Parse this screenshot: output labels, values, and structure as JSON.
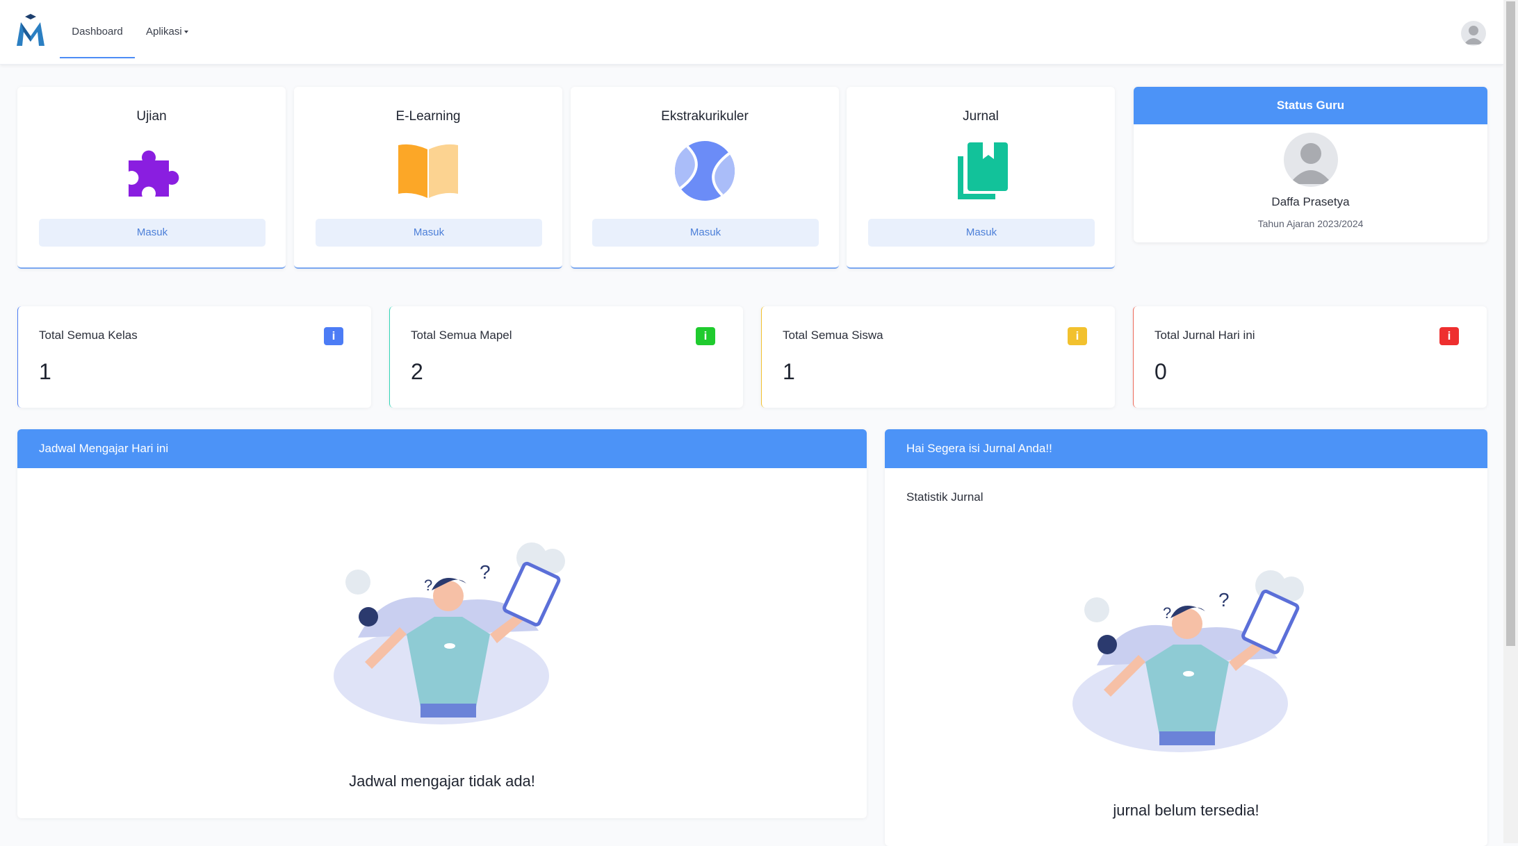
{
  "nav": {
    "items": [
      {
        "label": "Dashboard",
        "active": true
      },
      {
        "label": "Aplikasi",
        "active": false
      }
    ],
    "logo_icon": "school-logo-icon",
    "user_icon": "user-avatar-icon"
  },
  "apps": [
    {
      "title": "Ujian",
      "icon": "puzzle-icon",
      "button": "Masuk",
      "color": "#8a1ee0"
    },
    {
      "title": "E-Learning",
      "icon": "open-book-icon",
      "button": "Masuk",
      "color": "#fca727"
    },
    {
      "title": "Ekstrakurikuler",
      "icon": "tennis-ball-icon",
      "button": "Masuk",
      "color": "#6b8cf7"
    },
    {
      "title": "Jurnal",
      "icon": "journal-books-icon",
      "button": "Masuk",
      "color": "#12c29a"
    }
  ],
  "status": {
    "header": "Status Guru",
    "name": "Daffa Prasetya",
    "year": "Tahun Ajaran 2023/2024"
  },
  "stats": [
    {
      "label": "Total Semua Kelas",
      "value": "1",
      "badge": "i",
      "color": "#4c7cf5"
    },
    {
      "label": "Total Semua Mapel",
      "value": "2",
      "badge": "i",
      "color": "#1fcb2e"
    },
    {
      "label": "Total Semua Siswa",
      "value": "1",
      "badge": "i",
      "color": "#f2c12e"
    },
    {
      "label": "Total Jurnal Hari ini",
      "value": "0",
      "badge": "i",
      "color": "#ee2f2f"
    }
  ],
  "schedule": {
    "header": "Jadwal Mengajar Hari ini",
    "empty": "Jadwal mengajar tidak ada!"
  },
  "journal": {
    "header": "Hai Segera isi Jurnal Anda!!",
    "subtitle": "Statistik Jurnal",
    "empty": "jurnal belum tersedia!"
  }
}
